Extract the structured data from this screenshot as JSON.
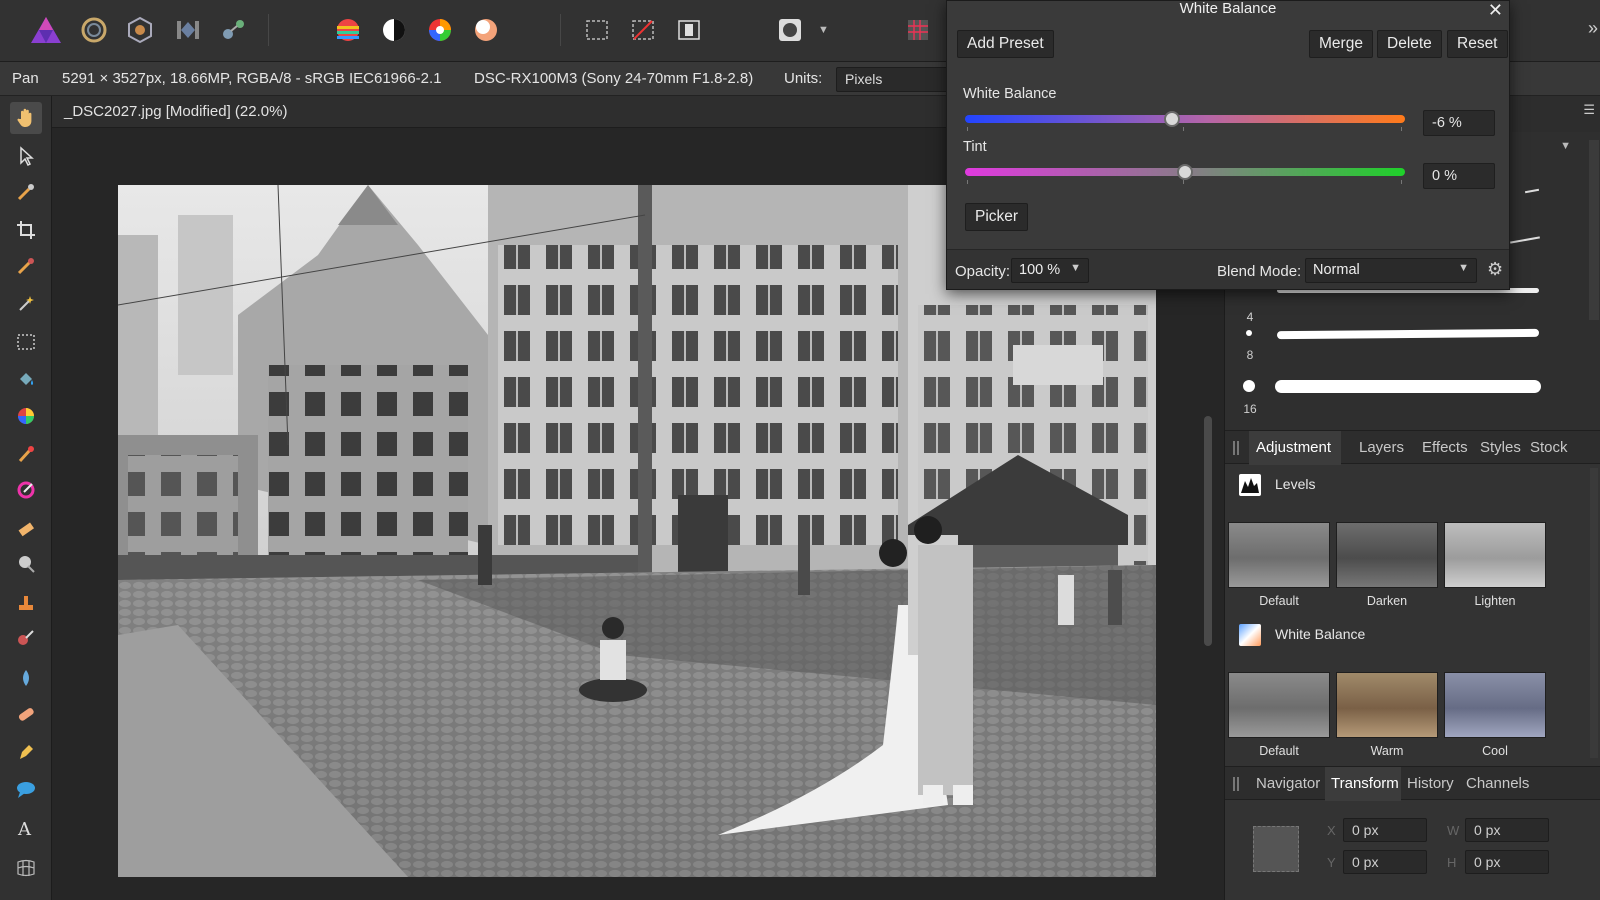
{
  "context": {
    "tool_name": "Pan",
    "image_info": "5291 × 3527px, 18.66MP, RGBA/8 - sRGB IEC61966-2.1",
    "camera": "DSC-RX100M3 (Sony 24-70mm F1.8-2.8)",
    "units_label": "Units:",
    "units_value": "Pixels"
  },
  "document": {
    "tab_title": "_DSC2027.jpg [Modified] (22.0%)"
  },
  "dialog": {
    "title": "White Balance",
    "add_preset": "Add Preset",
    "merge": "Merge",
    "delete": "Delete",
    "reset": "Reset",
    "sliders": [
      {
        "label": "White Balance",
        "value_text": "-6 %",
        "position_fraction": 0.47
      },
      {
        "label": "Tint",
        "value_text": "0 %",
        "position_fraction": 0.5
      }
    ],
    "picker": "Picker",
    "opacity_label": "Opacity:",
    "opacity_value": "100 %",
    "blend_label": "Blend Mode:",
    "blend_value": "Normal"
  },
  "brushes": {
    "sizes": [
      "4",
      "8",
      "16"
    ]
  },
  "adjustment_panel": {
    "tabs": [
      "Adjustment",
      "Layers",
      "Effects",
      "Styles",
      "Stock"
    ],
    "sections": [
      {
        "title": "Levels",
        "presets": [
          "Default",
          "Darken",
          "Lighten"
        ]
      },
      {
        "title": "White Balance",
        "presets": [
          "Default",
          "Warm",
          "Cool"
        ]
      }
    ]
  },
  "transform_panel": {
    "tabs": [
      "Navigator",
      "Transform",
      "History",
      "Channels"
    ],
    "x": "0 px",
    "y": "0 px",
    "w": "0 px",
    "h": "0 px",
    "letters": [
      "X",
      "Y",
      "W",
      "H"
    ]
  },
  "colors": {
    "accent": "#7b4fd6",
    "panel": "#333333",
    "dialog": "#3a3a3a"
  }
}
